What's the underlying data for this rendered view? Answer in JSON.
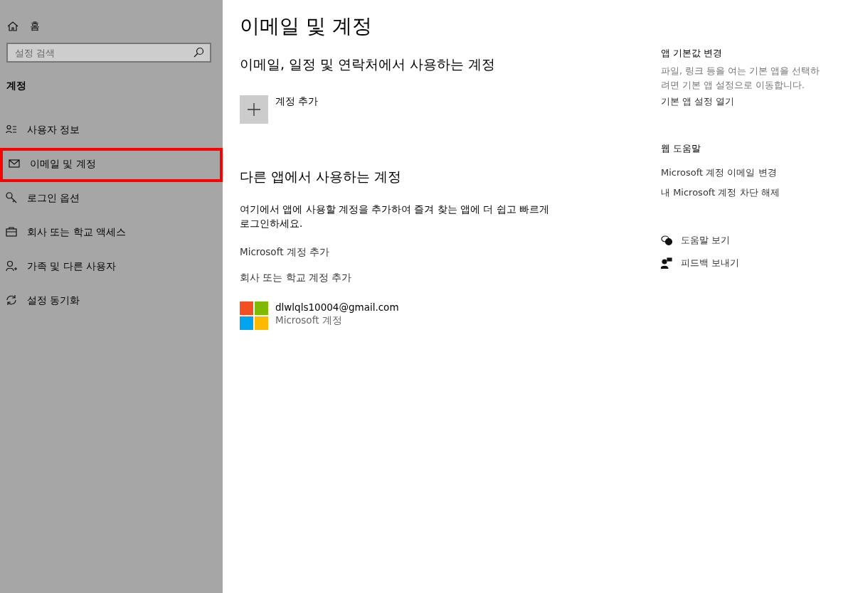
{
  "sidebar": {
    "home": "홈",
    "search": {
      "placeholder": "설정 검색"
    },
    "section": "계정",
    "items": [
      {
        "label": "사용자 정보",
        "kind": "user-info",
        "selected": false
      },
      {
        "label": "이메일 및 계정",
        "kind": "mail",
        "selected": true
      },
      {
        "label": "로그인 옵션",
        "kind": "key",
        "selected": false
      },
      {
        "label": "회사 또는 학교 액세스",
        "kind": "briefcase",
        "selected": false
      },
      {
        "label": "가족 및 다른 사용자",
        "kind": "user-add",
        "selected": false
      },
      {
        "label": "설정 동기화",
        "kind": "sync",
        "selected": false
      }
    ]
  },
  "main": {
    "title": "이메일 및 계정",
    "section1": {
      "heading": "이메일, 일정 및 연락처에서 사용하는 계정",
      "add_button": "계정 추가"
    },
    "section2": {
      "heading": "다른 앱에서 사용하는 계정",
      "description": "여기에서 앱에 사용할 계정을 추가하여 즐겨 찾는 앱에 더 쉽고 빠르게 로그인하세요.",
      "links": [
        "Microsoft 계정 추가",
        "회사 또는 학교 계정 추가"
      ],
      "account": {
        "email": "dlwlqls10004@gmail.com",
        "type": "Microsoft 계정"
      }
    }
  },
  "aside": {
    "defaults": {
      "heading": "앱 기본값 변경",
      "text": "파일, 링크 등을 여는 기본 앱을 선택하려면 기본 앱 설정으로 이동합니다.",
      "link": "기본 앱 설정 열기"
    },
    "help": {
      "heading": "웹 도움말",
      "links": [
        "Microsoft 계정 이메일 변경",
        "내 Microsoft 계정 차단 해제"
      ]
    },
    "actions": [
      {
        "label": "도움말 보기",
        "kind": "help"
      },
      {
        "label": "피드백 보내기",
        "kind": "feedback"
      }
    ]
  }
}
